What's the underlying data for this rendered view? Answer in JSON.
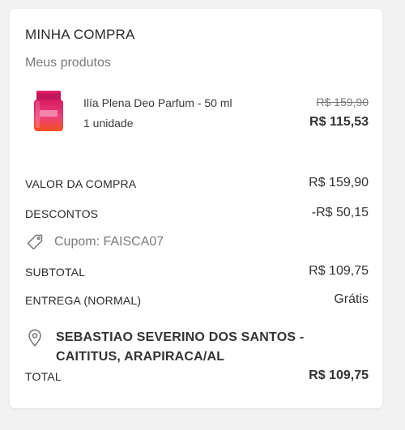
{
  "summary": {
    "title": "MINHA COMPRA",
    "subtitle": "Meus produtos"
  },
  "product": {
    "name": "Ilía Plena Deo Parfum - 50 ml",
    "quantity": "1 unidade",
    "price_original": "R$ 159,90",
    "price_final": "R$ 115,53",
    "image_icon": "perfume-bottle"
  },
  "totals": {
    "purchase_label": "VALOR DA COMPRA",
    "purchase_value": "R$ 159,90",
    "discounts_label": "DESCONTOS",
    "discounts_value": "-R$ 50,15",
    "coupon_text": "Cupom: FAISCA07",
    "subtotal_label": "SUBTOTAL",
    "subtotal_value": "R$ 109,75",
    "delivery_label": "ENTREGA (NORMAL)",
    "delivery_value": "Grátis",
    "address": "SEBASTIAO SEVERINO DOS SANTOS - CAITITUS, ARAPIRACA/AL",
    "total_label": "TOTAL",
    "total_value": "R$ 109,75"
  },
  "colors": {
    "bottle_pink": "#e8267a",
    "bottle_orange": "#f47a3a",
    "muted_text": "#7a7a7a"
  }
}
